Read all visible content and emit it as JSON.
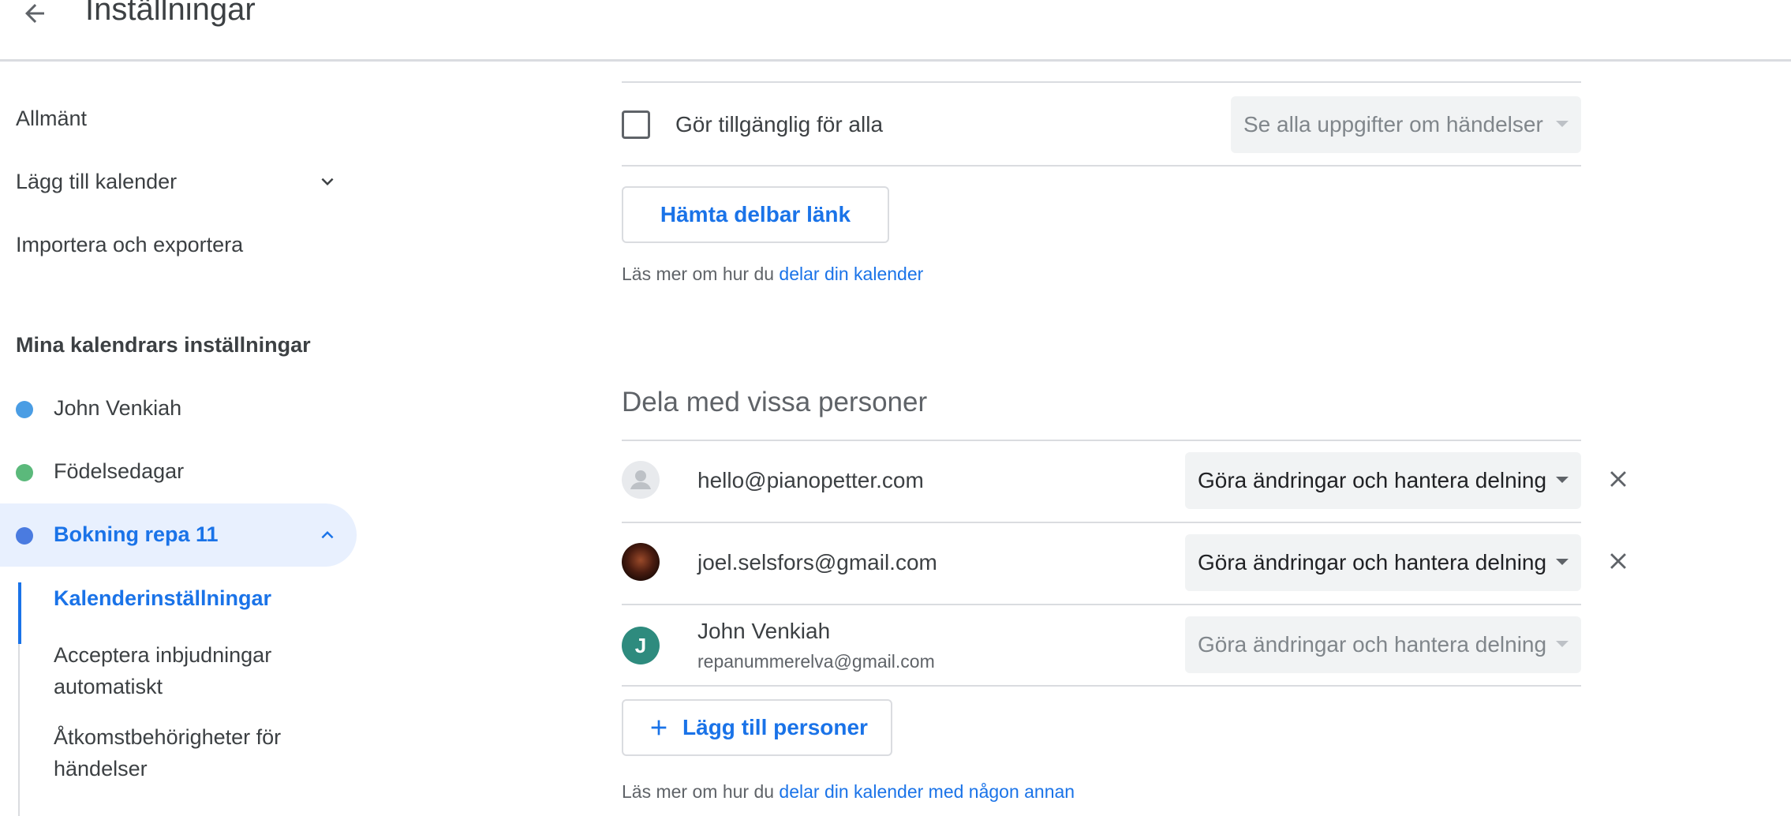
{
  "header": {
    "title": "Inställningar",
    "back_icon": "arrow-back-icon"
  },
  "sidebar": {
    "general": "Allmänt",
    "add_calendar": "Lägg till kalender",
    "import_export": "Importera och exportera",
    "my_calendars_heading": "Mina kalendrars inställningar",
    "calendars": [
      {
        "label": "John Venkiah",
        "color": "#4a9de4"
      },
      {
        "label": "Födelsedagar",
        "color": "#5bb97b"
      },
      {
        "label": "Bokning repa 11",
        "color": "#4a7be0"
      }
    ],
    "sub_items": [
      {
        "label": "Kalenderinställningar"
      },
      {
        "label": "Acceptera inbjudningar automatiskt"
      },
      {
        "label": "Åtkomstbehörigheter för händelser"
      }
    ]
  },
  "public_access": {
    "checkbox_label": "Gör tillgänglig för alla",
    "checked": false,
    "permission": "Se alla uppgifter om händelser",
    "share_link_button": "Hämta delbar länk",
    "help_prefix": "Läs mer om hur du",
    "help_link": "delar din kalender"
  },
  "share_people": {
    "title": "Dela med vissa personer",
    "people": [
      {
        "email": "hello@pianopetter.com",
        "permission": "Göra ändringar och hantera delning",
        "removable": true
      },
      {
        "email": "joel.selsfors@gmail.com",
        "permission": "Göra ändringar och hantera delning",
        "removable": true
      },
      {
        "name": "John Venkiah",
        "email": "repanummerelva@gmail.com",
        "initial": "J",
        "permission": "Göra ändringar och hantera delning",
        "removable": false
      }
    ],
    "add_button": "Lägg till personer",
    "help_prefix": "Läs mer om hur du",
    "help_link": "delar din kalender med någon annan"
  },
  "colors": {
    "accent": "#1a73e8",
    "active_bg": "#e8f0fe",
    "select_bg": "#f1f3f4"
  }
}
